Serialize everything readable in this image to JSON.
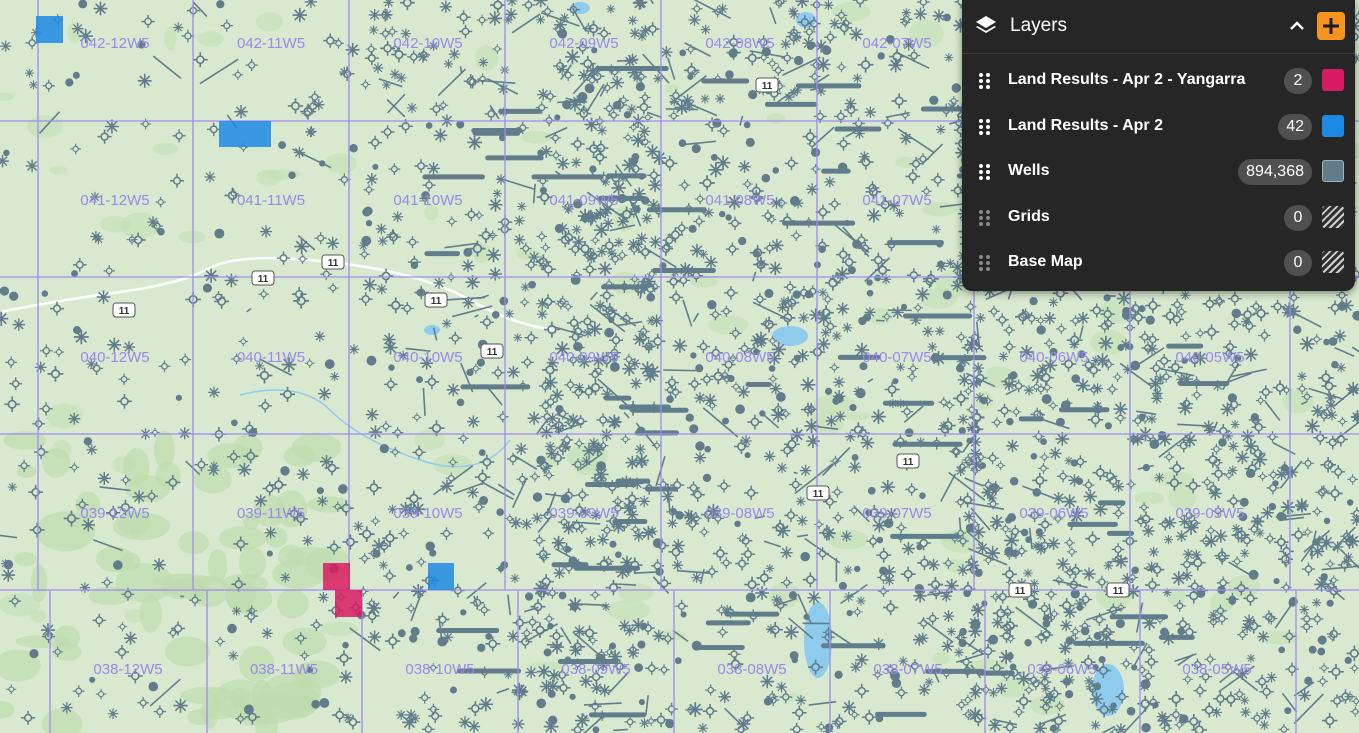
{
  "map": {
    "grid_labels": [
      "042-12W5",
      "042-11W5",
      "042-10W5",
      "042-09W5",
      "042-08W5",
      "042-07W5",
      "041-12W5",
      "041-11W5",
      "041-10W5",
      "041-09W5",
      "041-08W5",
      "041-07W5",
      "040-12W5",
      "040-11W5",
      "040-10W5",
      "040-09W5",
      "040-08W5",
      "040-07W5",
      "040-06W5",
      "040-05W5",
      "039-12W5",
      "039-11W5",
      "039-10W5",
      "039-09W5",
      "039-08W5",
      "039-07W5",
      "039-06W5",
      "039-05W5",
      "038-12W5",
      "038-11W5",
      "038-10W5",
      "038-09W5",
      "038-08W5",
      "038-07W5",
      "038-06W5",
      "038-05W5"
    ],
    "highway_shields": [
      "11",
      "11",
      "11",
      "11",
      "11",
      "11",
      "11",
      "11",
      "11",
      "11"
    ],
    "colors": {
      "base": "#d8e9cf",
      "forest": "#bfdcae",
      "grid_line": "#9e8cf0",
      "grid_label": "#9a88ea",
      "wells": "#617d8c",
      "water": "#8fcbed",
      "yangarra": "#d81b60",
      "apr2": "#1e88e5"
    }
  },
  "layers_panel": {
    "title": "Layers",
    "icon": "layers-icon",
    "collapse_icon": "chevron-up-icon",
    "add_icon": "plus-icon",
    "layers": [
      {
        "name": "Land Results - Apr 2 - Yangarra",
        "count": "2",
        "color": "#d81b60",
        "visible": true
      },
      {
        "name": "Land Results - Apr 2",
        "count": "42",
        "color": "#1e88e5",
        "visible": true
      },
      {
        "name": "Wells",
        "count": "894,368",
        "color": "#617d8c",
        "visible": true
      },
      {
        "name": "Grids",
        "count": "0",
        "color": "hatched",
        "visible": false
      },
      {
        "name": "Base Map",
        "count": "0",
        "color": "hatched",
        "visible": false
      }
    ]
  }
}
